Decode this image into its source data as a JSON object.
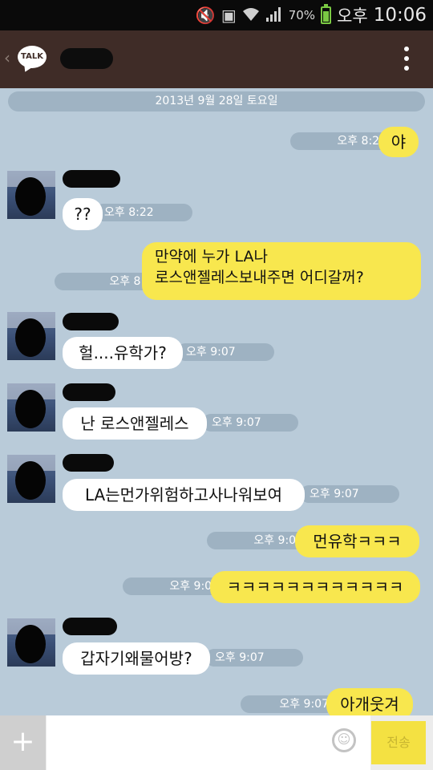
{
  "status_bar": {
    "battery_percent": "70%",
    "ampm": "오후",
    "time": "10:06",
    "icons": [
      "mute-icon",
      "screenshot-icon",
      "wifi-icon",
      "signal-icon",
      "battery-icon"
    ]
  },
  "header": {
    "app_logo_text": "TALK",
    "back_symbol": "‹"
  },
  "date_divider": "2013년 9월 28일 토요일",
  "messages": [
    {
      "side": "mine",
      "text": "야",
      "time": "오후 8:22"
    },
    {
      "side": "theirs",
      "text": "??",
      "time": "오후 8:22"
    },
    {
      "side": "mine",
      "text_lines": [
        "만약에 누가 LA나",
        "로스앤젤레스보내주면 어디갈꺼?"
      ],
      "time": "오후 8:22"
    },
    {
      "side": "theirs",
      "text": "헐....유학가?",
      "time": "오후 9:07"
    },
    {
      "side": "theirs",
      "text": "난 로스앤젤레스",
      "time": "오후 9:07"
    },
    {
      "side": "theirs",
      "text": "LA는먼가위험하고사나워보여",
      "time": "오후 9:07"
    },
    {
      "side": "mine",
      "text": "먼유학ㅋㅋㅋ",
      "time": "오후 9:07"
    },
    {
      "side": "mine",
      "text": "ㅋㅋㅋㅋㅋㅋㅋㅋㅋㅋㅋㅋ",
      "time": "오후 9:07"
    },
    {
      "side": "theirs",
      "text": "갑자기왜물어방?",
      "time": "오후 9:07"
    },
    {
      "side": "mine",
      "text": "아개웃겨",
      "time": "오후 9:07"
    }
  ],
  "input_bar": {
    "add_symbol": "+",
    "placeholder": "",
    "send_label": "전송"
  },
  "colors": {
    "chat_background": "#b9cbd9",
    "my_bubble": "#f8e74e",
    "their_bubble": "#ffffff",
    "header": "#3f2c27",
    "send_button": "#f4e142"
  }
}
